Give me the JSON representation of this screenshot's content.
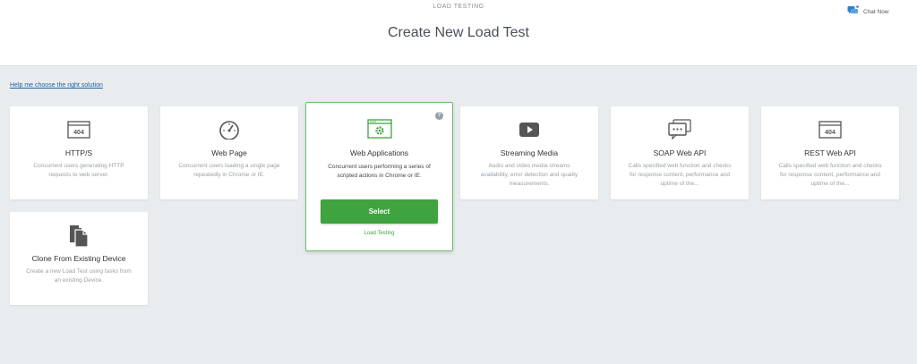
{
  "header": {
    "eyebrow": "LOAD TESTING",
    "title": "Create New Load Test",
    "chat_label": "Chat Now"
  },
  "help_link": "Help me choose the right solution",
  "cards": [
    {
      "title": "HTTP/S",
      "description": "Concurrent users generating HTTP requests to web server.",
      "icon": "http-404-icon"
    },
    {
      "title": "Web Page",
      "description": "Concurrent users loading a single page repeatedly in Chrome or IE.",
      "icon": "speedometer-icon"
    },
    {
      "title": "Web Applications",
      "description": "Concurrent users performing a series of scripted actions in Chrome or IE.",
      "icon": "web-app-gear-icon",
      "select_label": "Select",
      "category": "Load Testing",
      "help": "?"
    },
    {
      "title": "Streaming Media",
      "description": "Audio and video media streams availability, error detection and quality measurements.",
      "icon": "play-icon"
    },
    {
      "title": "SOAP Web API",
      "description": "Calls specified web function and checks for response content, performance and uptime of the...",
      "icon": "chat-bubbles-icon"
    },
    {
      "title": "REST Web API",
      "description": "Calls specified web function and checks for response content, performance and uptime of the...",
      "icon": "rest-404-icon"
    },
    {
      "title": "Clone From Existing Device",
      "description": "Create a new Load Test using tasks from an existing Device.",
      "icon": "documents-icon"
    }
  ],
  "colors": {
    "accent": "#3fa33f",
    "link": "#1f5f9e",
    "background": "#e9ecef"
  }
}
